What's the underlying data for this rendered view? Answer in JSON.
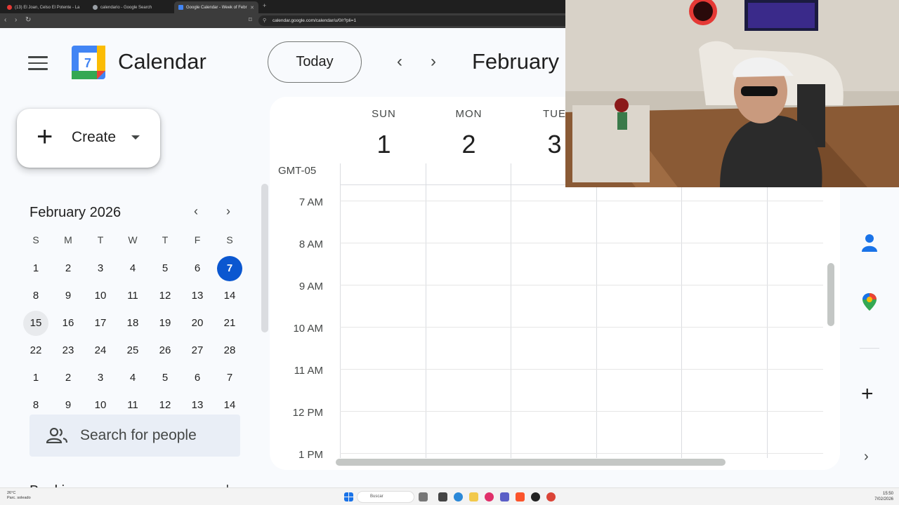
{
  "browser": {
    "tabs": [
      {
        "title": "(13) El Joan, Celso El Potente - La",
        "active": false
      },
      {
        "title": "calendario - Google Search",
        "active": false
      },
      {
        "title": "Google Calendar - Week of Febr",
        "active": true
      }
    ],
    "url": "calendar.google.com/calendar/u/0/r?pli=1"
  },
  "header": {
    "app_title": "Calendar",
    "logo_number": "7",
    "today_label": "Today",
    "period_label": "February"
  },
  "create": {
    "label": "Create"
  },
  "mini_calendar": {
    "title": "February 2026",
    "weekdays": [
      "S",
      "M",
      "T",
      "W",
      "T",
      "F",
      "S"
    ],
    "weeks": [
      [
        "1",
        "2",
        "3",
        "4",
        "5",
        "6",
        "7"
      ],
      [
        "8",
        "9",
        "10",
        "11",
        "12",
        "13",
        "14"
      ],
      [
        "15",
        "16",
        "17",
        "18",
        "19",
        "20",
        "21"
      ],
      [
        "22",
        "23",
        "24",
        "25",
        "26",
        "27",
        "28"
      ],
      [
        "1",
        "2",
        "3",
        "4",
        "5",
        "6",
        "7"
      ],
      [
        "8",
        "9",
        "10",
        "11",
        "12",
        "13",
        "14"
      ]
    ],
    "today": "7"
  },
  "search_people": {
    "label": "Search for people"
  },
  "booking": {
    "title": "Booking pages",
    "add": "+"
  },
  "week": {
    "timezone": "GMT-05",
    "days": [
      {
        "name": "SUN",
        "num": "1"
      },
      {
        "name": "MON",
        "num": "2"
      },
      {
        "name": "TUE",
        "num": "3"
      }
    ],
    "hours": [
      "7 AM",
      "8 AM",
      "9 AM",
      "10 AM",
      "11 AM",
      "12 PM",
      "1 PM"
    ]
  },
  "taskbar": {
    "weather_temp": "26°C",
    "weather_desc": "Parc. soleado",
    "search_placeholder": "Buscar",
    "time": "15:50",
    "date": "7/02/2026"
  },
  "colors": {
    "accent": "#0b57d0",
    "surface": "#f8fafd"
  }
}
